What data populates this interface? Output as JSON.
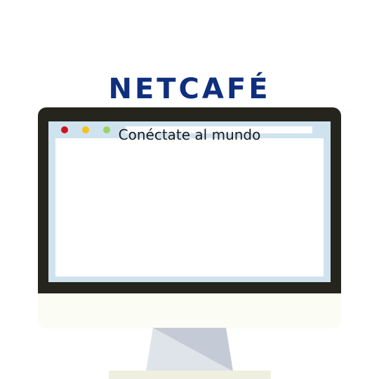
{
  "window": {
    "dots": [
      "close",
      "minimize",
      "maximize"
    ]
  },
  "screen": {
    "brand": "NETCAFÉ",
    "tagline": "Conéctate al mundo"
  },
  "colors": {
    "bezel": "#25251d",
    "chin": "#fbfcf4",
    "screen_frame": "#cfe3ef",
    "brand_text": "#0f2f7e",
    "close_dot": "#d0121c",
    "minimize_dot": "#f5c21a",
    "maximize_dot": "#9fd064",
    "stand_light": "#dfe4ea",
    "stand_shadow": "#c5cbd6",
    "base": "#efefdf"
  }
}
